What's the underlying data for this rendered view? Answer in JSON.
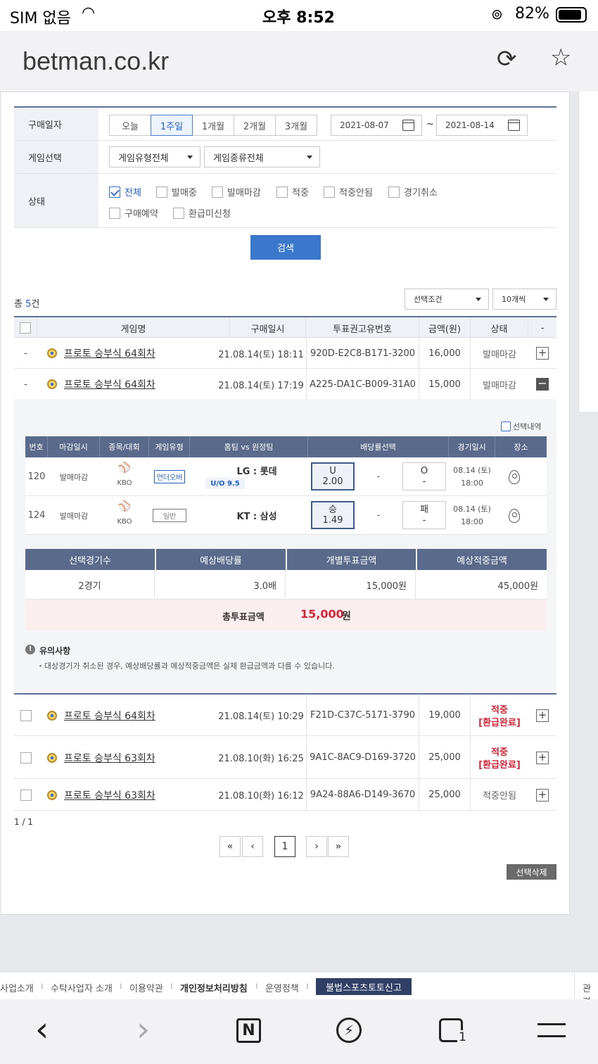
{
  "status": {
    "carrier": "SIM 없음",
    "time": "오후 8:52",
    "battery": "82%"
  },
  "browser": {
    "url": "betman.co.kr"
  },
  "filter": {
    "date_label": "구매일자",
    "ranges": [
      "오늘",
      "1주일",
      "1개월",
      "2개월",
      "3개월"
    ],
    "date_from": "2021-08-07",
    "date_tilde": "~",
    "date_to": "2021-08-14",
    "game_label": "게임선택",
    "game_type": "게임유형전체",
    "game_kind": "게임종류전체",
    "state_label": "상태",
    "states": [
      "전체",
      "발매중",
      "발매마감",
      "적중",
      "적중안됨",
      "경기취소",
      "구매예약",
      "환급미신청"
    ],
    "search": "검색"
  },
  "list": {
    "total_prefix": "총 ",
    "total_count": "5",
    "total_suffix": "건",
    "sort": "선택조건",
    "per_page": "10개씩",
    "headers": [
      "게임명",
      "구매일시",
      "투표권고유번호",
      "금액(원)",
      "상태",
      "-"
    ],
    "rows": [
      {
        "check": "-",
        "name": "프로토 승부식 64회차",
        "date": "21.08.14(토) 18:11",
        "id": "920D-E2C8-B171-3200",
        "amount": "16,000",
        "status": "발매마감",
        "toggle": "+"
      },
      {
        "check": "-",
        "name": "프로토 승부식 64회차",
        "date": "21.08.14(토) 17:19",
        "id": "A225-DA1C-B009-31A0",
        "amount": "15,000",
        "status": "발매마감",
        "toggle": "−"
      },
      {
        "name": "프로토 승부식 64회차",
        "date": "21.08.14(토) 10:29",
        "id": "F21D-C37C-5171-3790",
        "amount": "19,000",
        "status1": "적중",
        "status2": "[환급완료]",
        "toggle": "+"
      },
      {
        "name": "프로토 승부식 63회차",
        "date": "21.08.10(화) 16:25",
        "id": "9A1C-8AC9-D169-3720",
        "amount": "25,000",
        "status1": "적중",
        "status2": "[환급완료]",
        "toggle": "+"
      },
      {
        "name": "프로토 승부식 63회차",
        "date": "21.08.10(화) 16:12",
        "id": "9A24-88A6-D149-3670",
        "amount": "25,000",
        "status": "적중안됨",
        "toggle": "+"
      }
    ]
  },
  "detail": {
    "sel_label": "선택내역",
    "headers": [
      "번호",
      "마감일시",
      "종목/대회",
      "게임유형",
      "홈팀 vs 원정팀",
      "배당률선택",
      "경기일시",
      "장소"
    ],
    "games": [
      {
        "no": "120",
        "close": "발매마감",
        "league": "KBO",
        "type": "언더오버",
        "teams": "LG : 롯데",
        "sub": "U/O 9.5",
        "o1a": "U",
        "o1b": "2.00",
        "mid": "-",
        "o2a": "O",
        "o2b": "-",
        "date": "08.14 (토)",
        "time": "18:00"
      },
      {
        "no": "124",
        "close": "발매마감",
        "league": "KBO",
        "type": "일반",
        "teams": "KT : 삼성",
        "sub": "",
        "o1a": "승",
        "o1b": "1.49",
        "mid": "-",
        "o2a": "패",
        "o2b": "-",
        "date": "08.14 (토)",
        "time": "18:00"
      }
    ],
    "sum_headers": [
      "선택경기수",
      "예상배당률",
      "개별투표금액",
      "예상적중금액"
    ],
    "sum_values": [
      "2경기",
      "3.0배",
      "15,000원",
      "45,000원"
    ],
    "total_label": "총투표금액",
    "total_value": "15,000",
    "total_unit": "원",
    "notice_title": "유의사항",
    "notice_text": "・대상경기가 취소된 경우, 예상배당률과 예상적중금액은 실제 환급금액과 다를 수 있습니다."
  },
  "pager": {
    "info": "1 / 1",
    "first": "«",
    "prev": "‹",
    "current": "1",
    "next": "›",
    "last": "»",
    "delete": "선택삭제"
  },
  "footer": {
    "links": [
      "사업소개",
      "수탁사업자 소개",
      "이용약관",
      "개인정보처리방침",
      "운영정책"
    ],
    "report": "불법스포츠토토신고",
    "more": "관련"
  },
  "tabs": {
    "count": "1"
  }
}
